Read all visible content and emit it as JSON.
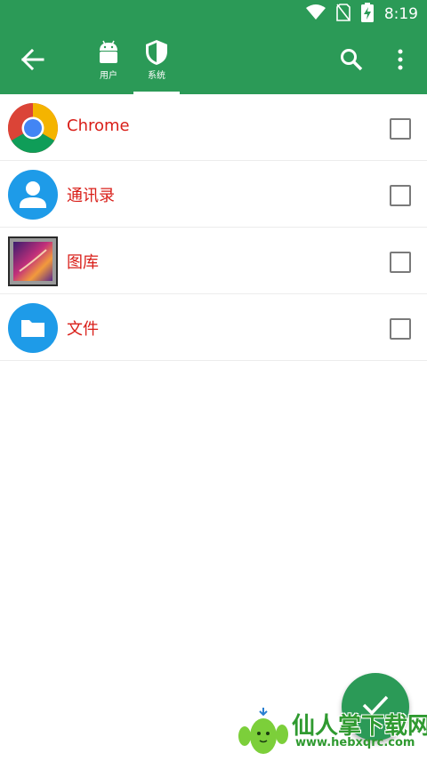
{
  "status_bar": {
    "time": "8:19",
    "icons": [
      "wifi-icon",
      "no-sim-icon",
      "battery-charging-icon"
    ]
  },
  "app_bar": {
    "back_icon": "arrow-left-icon",
    "tabs": [
      {
        "label": "用户",
        "icon": "android-icon",
        "selected": false
      },
      {
        "label": "系统",
        "icon": "shield-icon",
        "selected": true
      }
    ],
    "actions": [
      "search-icon",
      "more-vert-icon"
    ]
  },
  "apps": [
    {
      "name": "Chrome",
      "icon": "chrome-icon",
      "checked": false
    },
    {
      "name": "通讯录",
      "icon": "contacts-icon",
      "checked": false
    },
    {
      "name": "图库",
      "icon": "gallery-icon",
      "checked": false
    },
    {
      "name": "文件",
      "icon": "files-icon",
      "checked": false
    }
  ],
  "fab": {
    "icon": "check-icon"
  },
  "watermark": {
    "title": "仙人掌下载网",
    "url": "www.hebxqrc.com"
  },
  "colors": {
    "primary": "#2b9a57",
    "app_name": "#d91e18",
    "checkbox_border": "#7a7a7a"
  }
}
